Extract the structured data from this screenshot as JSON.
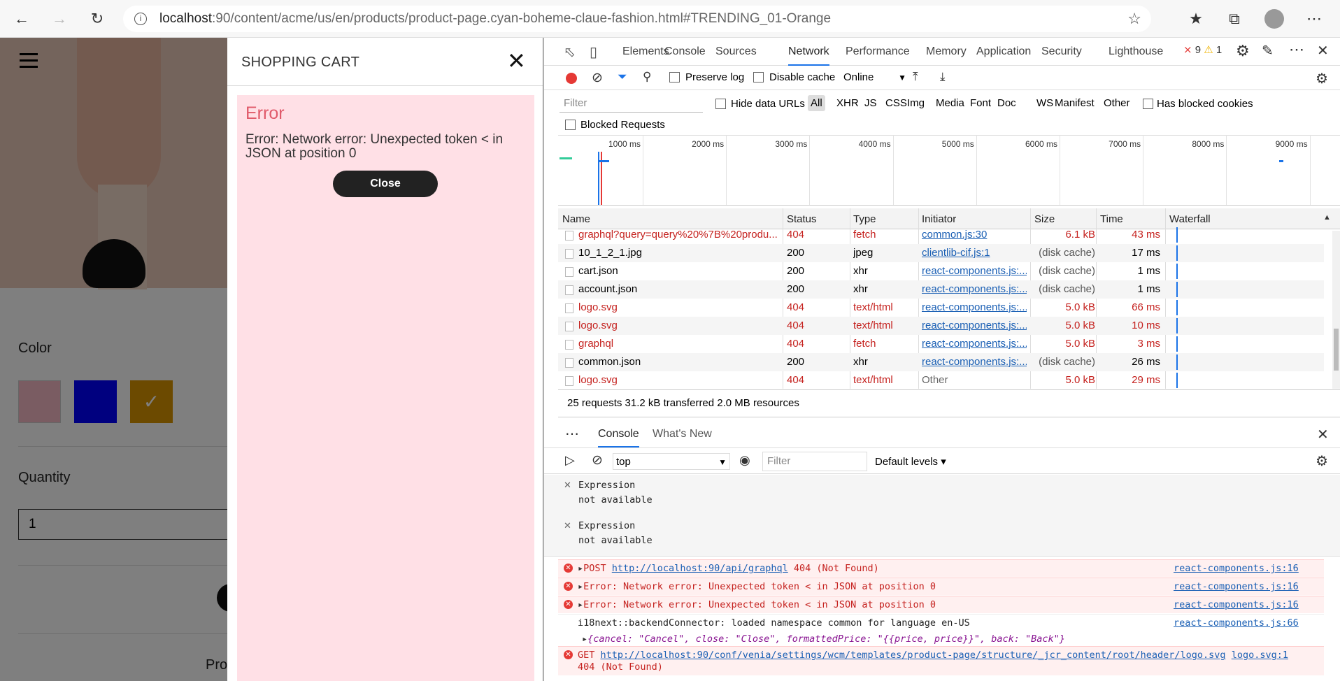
{
  "browser": {
    "url_host": "localhost",
    "url_rest": ":90/content/acme/us/en/products/product-page.cyan-boheme-claue-fashion.html#TRENDING_01-Orange"
  },
  "page": {
    "color_label": "Color",
    "quantity_label": "Quantity",
    "quantity_value": "1",
    "product_partial": "Pro",
    "swatch_colors": [
      "#f4b8c4",
      "#0000ff",
      "#d99400"
    ]
  },
  "cart": {
    "title": "SHOPPING CART",
    "error_heading": "Error",
    "error_message": "Error: Network error: Unexpected token < in JSON at position 0",
    "close_button": "Close"
  },
  "devtools": {
    "tabs": [
      "Elements",
      "Console",
      "Sources",
      "Network",
      "Performance",
      "Memory",
      "Application",
      "Security",
      "Lighthouse"
    ],
    "active_tab": "Network",
    "error_count": "9",
    "warning_count": "1",
    "preserve_log": "Preserve log",
    "disable_cache": "Disable cache",
    "throttle": "Online",
    "filter_placeholder": "Filter",
    "hide_data_urls": "Hide data URLs",
    "type_filters": [
      "All",
      "XHR",
      "JS",
      "CSS",
      "Img",
      "Media",
      "Font",
      "Doc",
      "WS",
      "Manifest",
      "Other"
    ],
    "has_blocked_cookies": "Has blocked cookies",
    "blocked_requests": "Blocked Requests",
    "timeline_ticks": [
      "1000 ms",
      "2000 ms",
      "3000 ms",
      "4000 ms",
      "5000 ms",
      "6000 ms",
      "7000 ms",
      "8000 ms",
      "9000 ms"
    ],
    "columns": [
      "Name",
      "Status",
      "Type",
      "Initiator",
      "Size",
      "Time",
      "Waterfall"
    ],
    "requests": [
      {
        "name": "graphql?query=query%20%7B%20produ...",
        "status": "404",
        "type": "fetch",
        "initiator": "common.js:30",
        "size": "6.1 kB",
        "time": "43 ms",
        "error": true
      },
      {
        "name": "10_1_2_1.jpg",
        "status": "200",
        "type": "jpeg",
        "initiator": "clientlib-cif.js:1",
        "size": "(disk cache)",
        "time": "17 ms",
        "error": false
      },
      {
        "name": "cart.json",
        "status": "200",
        "type": "xhr",
        "initiator": "react-components.js:...",
        "size": "(disk cache)",
        "time": "1 ms",
        "error": false
      },
      {
        "name": "account.json",
        "status": "200",
        "type": "xhr",
        "initiator": "react-components.js:...",
        "size": "(disk cache)",
        "time": "1 ms",
        "error": false
      },
      {
        "name": "logo.svg",
        "status": "404",
        "type": "text/html",
        "initiator": "react-components.js:...",
        "size": "5.0 kB",
        "time": "66 ms",
        "error": true
      },
      {
        "name": "logo.svg",
        "status": "404",
        "type": "text/html",
        "initiator": "react-components.js:...",
        "size": "5.0 kB",
        "time": "10 ms",
        "error": true
      },
      {
        "name": "graphql",
        "status": "404",
        "type": "fetch",
        "initiator": "react-components.js:...",
        "size": "5.0 kB",
        "time": "3 ms",
        "error": true
      },
      {
        "name": "common.json",
        "status": "200",
        "type": "xhr",
        "initiator": "react-components.js:...",
        "size": "(disk cache)",
        "time": "26 ms",
        "error": false
      },
      {
        "name": "logo.svg",
        "status": "404",
        "type": "text/html",
        "initiator": "Other",
        "size": "5.0 kB",
        "time": "29 ms",
        "error": true
      }
    ],
    "summary": "25 requests  31.2 kB transferred  2.0 MB resources",
    "drawer_tabs": [
      "Console",
      "What's New"
    ],
    "context": "top",
    "console_filter_placeholder": "Filter",
    "default_levels": "Default levels",
    "expressions": [
      {
        "label": "Expression",
        "value": "not available"
      },
      {
        "label": "Expression",
        "value": "not available"
      }
    ],
    "console_messages": [
      {
        "text_pre": "POST ",
        "link": "http://localhost:90/api/graphql",
        "text_post": " 404 (Not Found)",
        "source": "react-components.js:16",
        "error": true
      },
      {
        "text_pre": "Error: Network error: Unexpected token < in JSON at position 0",
        "link": "",
        "text_post": "",
        "source": "react-components.js:16",
        "error": true
      },
      {
        "text_pre": "Error: Network error: Unexpected token < in JSON at position 0",
        "link": "",
        "text_post": "",
        "source": "react-components.js:16",
        "error": true
      },
      {
        "text_pre": "i18next::backendConnector: loaded namespace common for language en-US",
        "link": "",
        "text_post": "",
        "source": "react-components.js:66",
        "error": false
      }
    ],
    "object_preview": "{cancel: \"Cancel\", close: \"Close\", formattedPrice: \"{{price, price}}\", back: \"Back\"}",
    "get_error": {
      "text_pre": "GET ",
      "link": "http://localhost:90/conf/venia/settings/wcm/templates/product-page/structure/_jcr_content/root/header/logo.svg",
      "source": "logo.svg:1",
      "line2": "404 (Not Found)"
    }
  }
}
